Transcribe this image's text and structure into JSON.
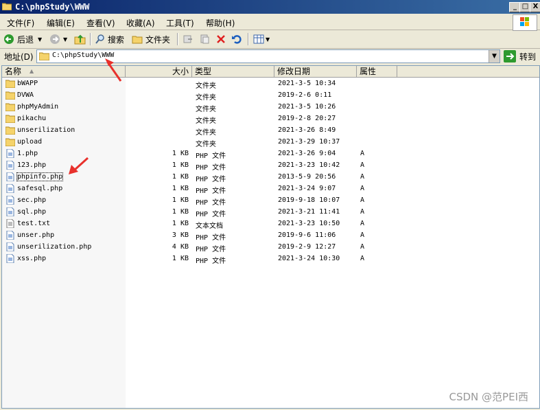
{
  "window": {
    "title": "C:\\phpStudy\\WWW",
    "min": "_",
    "max": "□",
    "close": "X"
  },
  "menu": [
    "文件(F)",
    "编辑(E)",
    "查看(V)",
    "收藏(A)",
    "工具(T)",
    "帮助(H)"
  ],
  "toolbar": {
    "back": "后退",
    "search": "搜索",
    "folders": "文件夹"
  },
  "address": {
    "label": "地址(D)",
    "value": "C:\\phpStudy\\WWW",
    "go": "转到"
  },
  "columns": {
    "name": "名称",
    "size": "大小",
    "type": "类型",
    "modified": "修改日期",
    "attr": "属性"
  },
  "files": [
    {
      "name": "bWAPP",
      "size": "",
      "type": "文件夹",
      "date": "2021-3-5 10:34",
      "attr": "",
      "kind": "folder"
    },
    {
      "name": "DVWA",
      "size": "",
      "type": "文件夹",
      "date": "2019-2-6 0:11",
      "attr": "",
      "kind": "folder"
    },
    {
      "name": "phpMyAdmin",
      "size": "",
      "type": "文件夹",
      "date": "2021-3-5 10:26",
      "attr": "",
      "kind": "folder"
    },
    {
      "name": "pikachu",
      "size": "",
      "type": "文件夹",
      "date": "2019-2-8 20:27",
      "attr": "",
      "kind": "folder"
    },
    {
      "name": "unserilization",
      "size": "",
      "type": "文件夹",
      "date": "2021-3-26 8:49",
      "attr": "",
      "kind": "folder"
    },
    {
      "name": "upload",
      "size": "",
      "type": "文件夹",
      "date": "2021-3-29 10:37",
      "attr": "",
      "kind": "folder"
    },
    {
      "name": "1.php",
      "size": "1 KB",
      "type": "PHP 文件",
      "date": "2021-3-26 9:04",
      "attr": "A",
      "kind": "php"
    },
    {
      "name": "123.php",
      "size": "1 KB",
      "type": "PHP 文件",
      "date": "2021-3-23 10:42",
      "attr": "A",
      "kind": "php"
    },
    {
      "name": "phpinfo.php",
      "size": "1 KB",
      "type": "PHP 文件",
      "date": "2013-5-9 20:56",
      "attr": "A",
      "kind": "php"
    },
    {
      "name": "safesql.php",
      "size": "1 KB",
      "type": "PHP 文件",
      "date": "2021-3-24 9:07",
      "attr": "A",
      "kind": "php"
    },
    {
      "name": "sec.php",
      "size": "1 KB",
      "type": "PHP 文件",
      "date": "2019-9-18 10:07",
      "attr": "A",
      "kind": "php"
    },
    {
      "name": "sql.php",
      "size": "1 KB",
      "type": "PHP 文件",
      "date": "2021-3-21 11:41",
      "attr": "A",
      "kind": "php"
    },
    {
      "name": "test.txt",
      "size": "1 KB",
      "type": "文本文档",
      "date": "2021-3-23 10:50",
      "attr": "A",
      "kind": "txt"
    },
    {
      "name": "unser.php",
      "size": "3 KB",
      "type": "PHP 文件",
      "date": "2019-9-6 11:06",
      "attr": "A",
      "kind": "php"
    },
    {
      "name": "unserilization.php",
      "size": "4 KB",
      "type": "PHP 文件",
      "date": "2019-2-9 12:27",
      "attr": "A",
      "kind": "php"
    },
    {
      "name": "xss.php",
      "size": "1 KB",
      "type": "PHP 文件",
      "date": "2021-3-24 10:30",
      "attr": "A",
      "kind": "php"
    }
  ],
  "watermark": "CSDN @范PEI西",
  "colors": {
    "titlebar": "#0a246a",
    "annotation_arrow": "#e8312c"
  }
}
